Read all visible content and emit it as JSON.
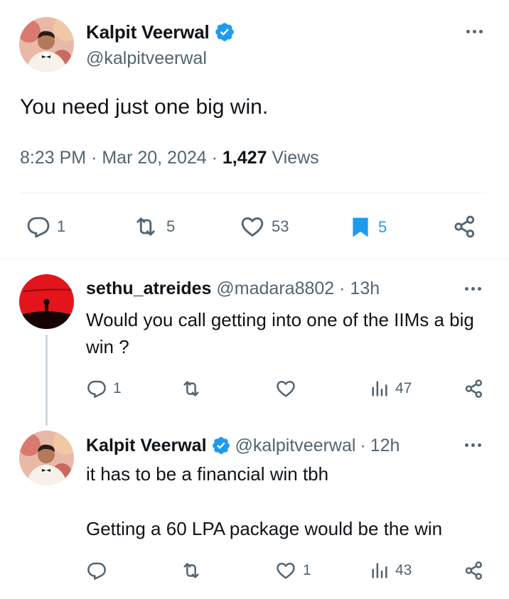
{
  "main_tweet": {
    "author_name": "Kalpit Veerwal",
    "handle": "@kalpitveerwal",
    "text": "You need just one big win.",
    "time": "8:23 PM",
    "date": "Mar 20, 2024",
    "views_count": "1,427",
    "views_label": "Views",
    "replies": "1",
    "reposts": "5",
    "likes": "53",
    "bookmarks": "5"
  },
  "reply_1": {
    "author_name": "sethu_atreides",
    "handle": "@madara8802",
    "age": "13h",
    "text": "Would you call getting into one of the IIMs a big win ?",
    "replies": "1",
    "reposts": "",
    "likes": "",
    "views": "47"
  },
  "reply_2": {
    "author_name": "Kalpit Veerwal",
    "handle": "@kalpitveerwal",
    "age": "12h",
    "text_line_1": "it has to be a financial win tbh",
    "text_line_2": "Getting a 60 LPA package would be the win",
    "replies": "",
    "reposts": "",
    "likes": "1",
    "views": "43"
  },
  "separator": "·",
  "colors": {
    "text": "#0f1419",
    "muted": "#536471",
    "accent": "#1d9bf0",
    "divider": "#eff3f4"
  }
}
